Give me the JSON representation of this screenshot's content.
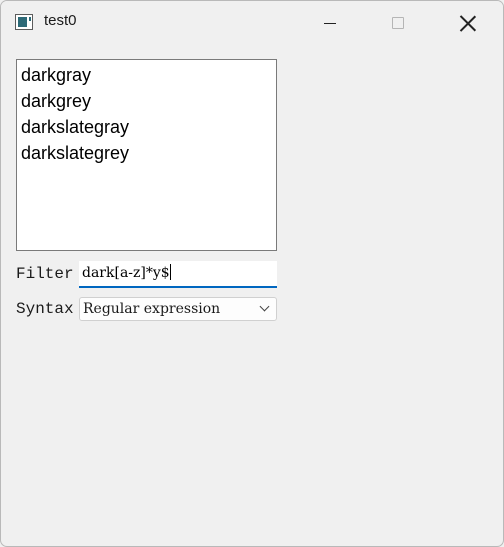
{
  "window": {
    "title": "test0"
  },
  "titlebar_buttons": {
    "minimize": "minimize-icon",
    "maximize": "maximize-icon",
    "close": "close-icon"
  },
  "list": {
    "items": [
      "darkgray",
      "darkgrey",
      "darkslategray",
      "darkslategrey"
    ]
  },
  "filter": {
    "label": "Filter",
    "value": "dark[a-z]*y$"
  },
  "syntax": {
    "label": "Syntax",
    "selected": "Regular expression"
  },
  "colors": {
    "accent": "#0067c0",
    "background": "#f0f0f0"
  }
}
